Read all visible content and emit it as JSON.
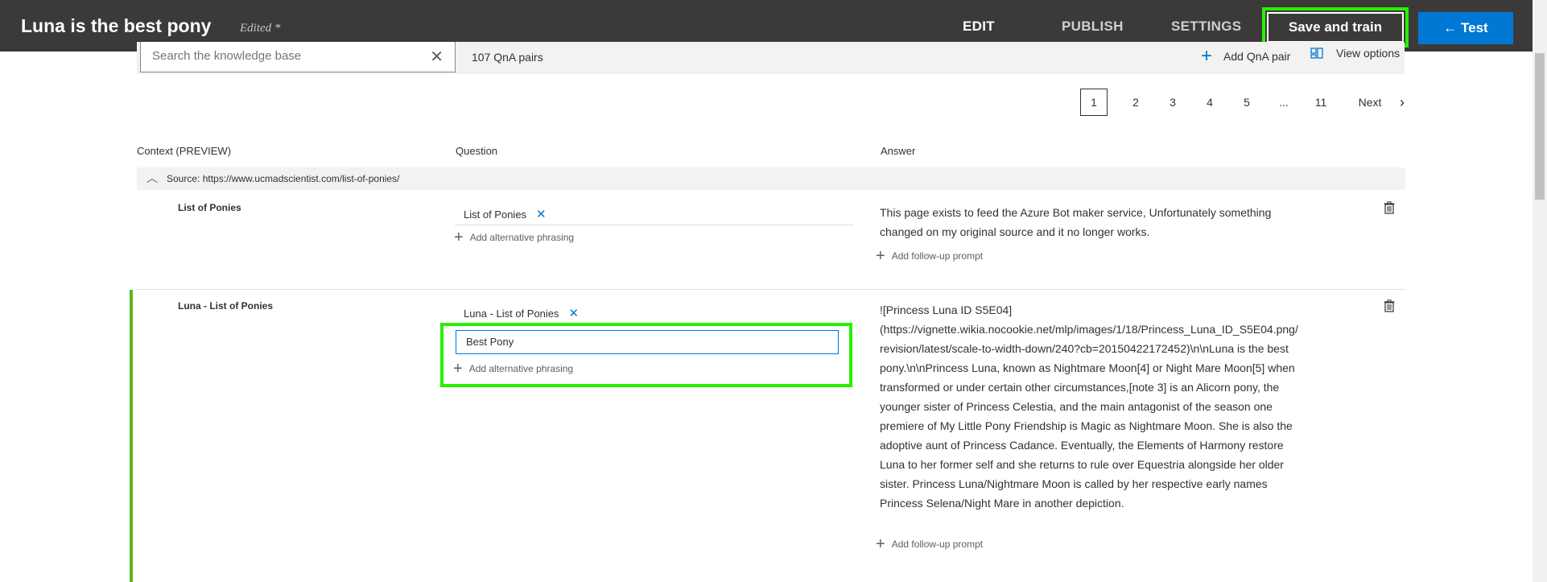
{
  "header": {
    "kb_title": "Luna is the best pony",
    "edited_label": "Edited *",
    "tabs": [
      {
        "label": "EDIT",
        "active": true
      },
      {
        "label": "PUBLISH",
        "active": false
      },
      {
        "label": "SETTINGS",
        "active": false
      }
    ],
    "save_label": "Save and train",
    "test_label": "← Test"
  },
  "toolbar": {
    "search_placeholder": "Search the knowledge base",
    "qna_count": "107 QnA pairs",
    "add_qna_label": "Add QnA pair",
    "view_options_label": "View options"
  },
  "pagination": {
    "current": "1",
    "pages": [
      "2",
      "3",
      "4",
      "5",
      "...",
      "11"
    ],
    "next_label": "Next"
  },
  "table": {
    "headers": {
      "context": "Context (PREVIEW)",
      "question": "Question",
      "answer": "Answer"
    },
    "source": "Source: https://www.ucmadscientist.com/list-of-ponies/",
    "add_alt_label": "Add alternative phrasing",
    "add_followup_label": "Add follow-up prompt",
    "rows": [
      {
        "context": "List of Ponies",
        "question": "List of Ponies",
        "answer": "This page exists to feed the Azure Bot maker service, Unfortunately something changed on my original source and it no longer works."
      },
      {
        "context": "Luna - List of Ponies",
        "question": "Luna - List of Ponies",
        "alt_input_value": "Best Pony",
        "answer": "![Princess Luna ID S5E04](https://vignette.wikia.nocookie.net/mlp/images/1/18/Princess_Luna_ID_S5E04.png/revision/latest/scale-to-width-down/240?cb=20150422172452)\\n\\nLuna is the best pony.\\n\\nPrincess Luna, known as Nightmare Moon[4] or Night Mare Moon[5] when transformed or under certain other circumstances,[note 3] is an Alicorn pony, the younger sister of Princess Celestia, and the main antagonist of the season one premiere of My Little Pony Friendship is Magic as Nightmare Moon. She is also the adoptive aunt of Princess Cadance. Eventually, the Elements of Harmony restore Luna to her former self and she returns to rule over Equestria alongside her older sister. Princess Luna/Nightmare Moon is called by her respective early names Princess Selena/Night Mare in another depiction."
      }
    ]
  },
  "colors": {
    "topbar": "#3b3a39",
    "accent": "#0078d4",
    "highlight": "#26f000",
    "row_marker": "#57b820"
  },
  "icons": [
    "clear-icon",
    "plus-icon",
    "view-options-icon",
    "chevron-right-icon",
    "chevron-up-icon",
    "close-icon",
    "trash-icon"
  ]
}
